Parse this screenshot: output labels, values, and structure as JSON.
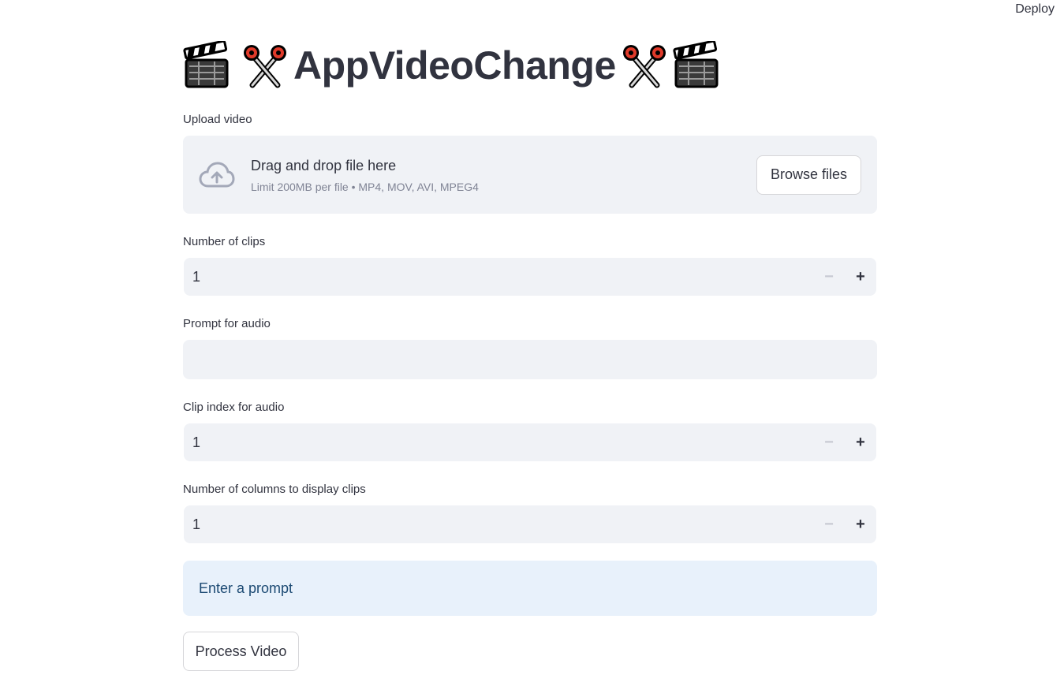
{
  "header": {
    "deploy_label": "Deploy"
  },
  "title": {
    "text": "AppVideoChange",
    "icons": [
      "clapper-board-icon",
      "scissors-icon",
      "scissors-icon",
      "clapper-board-icon"
    ]
  },
  "upload": {
    "label": "Upload video",
    "drag_text": "Drag and drop file here",
    "limit_text": "Limit 200MB per file • MP4, MOV, AVI, MPEG4",
    "browse_label": "Browse files",
    "icon": "cloud-upload-icon"
  },
  "num_clips": {
    "label": "Number of clips",
    "value": "1"
  },
  "prompt_audio": {
    "label": "Prompt for audio",
    "value": ""
  },
  "clip_index": {
    "label": "Clip index for audio",
    "value": "1"
  },
  "num_columns": {
    "label": "Number of columns to display clips",
    "value": "1"
  },
  "stepper": {
    "minus": "−",
    "plus": "+"
  },
  "info": {
    "text": "Enter a prompt"
  },
  "process": {
    "label": "Process Video"
  },
  "colors": {
    "text": "#31333f",
    "input_bg": "#f0f2f6",
    "info_bg": "#e8f1fb",
    "info_text": "#1c4a73",
    "muted": "#808495"
  }
}
